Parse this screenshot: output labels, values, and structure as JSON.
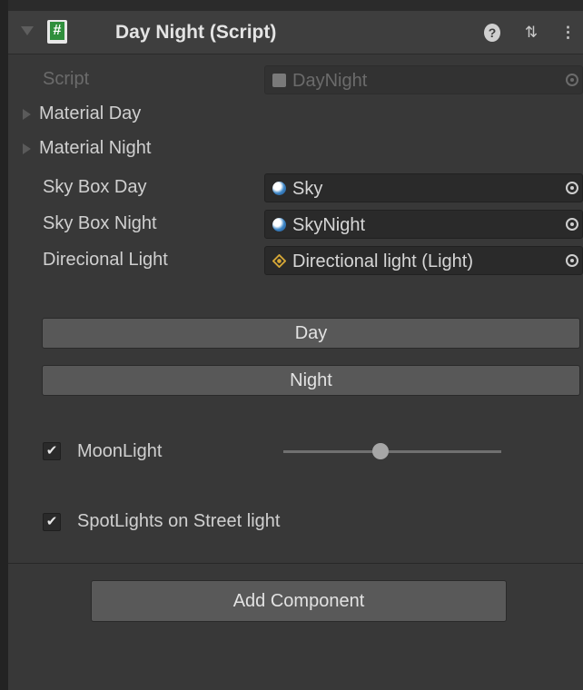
{
  "component": {
    "title": "Day Night (Script)",
    "header_icons": [
      "help-icon",
      "preset-icon",
      "kebab-menu-icon"
    ]
  },
  "properties": {
    "script": {
      "label": "Script",
      "value": "DayNight"
    },
    "material_day": {
      "label": "Material Day"
    },
    "material_night": {
      "label": "Material Night"
    },
    "sky_box_day": {
      "label": "Sky Box Day",
      "value": "Sky"
    },
    "sky_box_night": {
      "label": "Sky Box Night",
      "value": "SkyNight"
    },
    "directional_light": {
      "label": "Direcional Light",
      "value": "Directional light (Light)"
    }
  },
  "buttons": {
    "day": "Day",
    "night": "Night",
    "add_component": "Add Component"
  },
  "toggles": {
    "moonlight": {
      "label": "MoonLight",
      "checked": true,
      "slider_fraction": 0.43
    },
    "spotlights": {
      "label": "SpotLights on Street light",
      "checked": true
    }
  },
  "glyphs": {
    "hash": "#",
    "help": "?",
    "preset": "⇅",
    "menu": "⋮",
    "check": "✔"
  },
  "colors": {
    "background": "#383838",
    "header": "#3e3e3e",
    "field": "#2a2a2a",
    "button": "#585858",
    "script_icon_green": "#2f8f3c",
    "light_icon": "#d4a637"
  }
}
